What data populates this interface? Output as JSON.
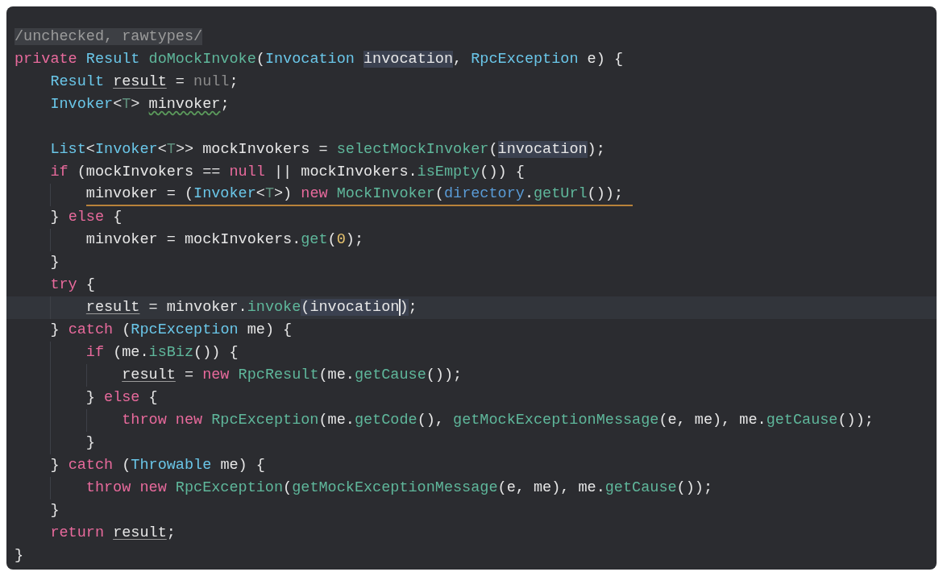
{
  "lines": [
    {
      "kind": "normal",
      "tokens": [
        {
          "text": "/unchecked, rawtypes/",
          "kind": "annotation"
        }
      ]
    },
    {
      "kind": "normal",
      "tokens": [
        {
          "text": "private ",
          "kind": "keyword"
        },
        {
          "text": "Result ",
          "kind": "type"
        },
        {
          "text": "doMockInvoke",
          "kind": "function"
        },
        {
          "text": "(",
          "kind": "plain"
        },
        {
          "text": "Invocation ",
          "kind": "type"
        },
        {
          "text": "invocation",
          "kind": "matched"
        },
        {
          "text": ", ",
          "kind": "plain"
        },
        {
          "text": "RpcException ",
          "kind": "type"
        },
        {
          "text": "e) {",
          "kind": "plain"
        }
      ],
      "children": [
        {
          "kind": "normal",
          "tokens": [
            {
              "text": "Result ",
              "kind": "type"
            },
            {
              "text": "result",
              "kind": "underlined"
            },
            {
              "text": " = ",
              "kind": "plain"
            },
            {
              "text": "null",
              "kind": "muted"
            },
            {
              "text": ";",
              "kind": "plain"
            }
          ]
        },
        {
          "kind": "normal",
          "tokens": [
            {
              "text": "Invoker",
              "kind": "type"
            },
            {
              "text": "<",
              "kind": "plain"
            },
            {
              "text": "T",
              "kind": "typeparam"
            },
            {
              "text": "> ",
              "kind": "plain"
            },
            {
              "text": "minvoker",
              "kind": "wavy"
            },
            {
              "text": ";",
              "kind": "plain"
            }
          ]
        },
        {
          "kind": "blank"
        },
        {
          "kind": "normal",
          "tokens": [
            {
              "text": "List",
              "kind": "type"
            },
            {
              "text": "<",
              "kind": "plain"
            },
            {
              "text": "Invoker",
              "kind": "type"
            },
            {
              "text": "<",
              "kind": "plain"
            },
            {
              "text": "T",
              "kind": "typeparam"
            },
            {
              "text": ">> mockInvokers = ",
              "kind": "plain"
            },
            {
              "text": "selectMockInvoker",
              "kind": "function"
            },
            {
              "text": "(",
              "kind": "plain"
            },
            {
              "text": "invocation",
              "kind": "matched"
            },
            {
              "text": ");",
              "kind": "plain"
            }
          ]
        },
        {
          "kind": "normal",
          "tokens": [
            {
              "text": "if ",
              "kind": "keyword"
            },
            {
              "text": "(mockInvokers == ",
              "kind": "plain"
            },
            {
              "text": "null",
              "kind": "keyword"
            },
            {
              "text": " || mockInvokers.",
              "kind": "plain"
            },
            {
              "text": "isEmpty",
              "kind": "function"
            },
            {
              "text": "()) {",
              "kind": "plain"
            }
          ],
          "children": [
            {
              "kind": "flagged",
              "tokens": [
                {
                  "text": "minvoker = (",
                  "kind": "plain"
                },
                {
                  "text": "Invoker",
                  "kind": "type"
                },
                {
                  "text": "<",
                  "kind": "plain"
                },
                {
                  "text": "T",
                  "kind": "typeparam"
                },
                {
                  "text": ">) ",
                  "kind": "plain"
                },
                {
                  "text": "new ",
                  "kind": "keyword"
                },
                {
                  "text": "MockInvoker",
                  "kind": "function"
                },
                {
                  "text": "(",
                  "kind": "plain"
                },
                {
                  "text": "directory",
                  "kind": "field"
                },
                {
                  "text": ".",
                  "kind": "plain"
                },
                {
                  "text": "getUrl",
                  "kind": "function"
                },
                {
                  "text": "());",
                  "kind": "plain"
                }
              ]
            }
          ]
        },
        {
          "kind": "normal",
          "tokens": [
            {
              "text": "} ",
              "kind": "plain"
            },
            {
              "text": "else ",
              "kind": "keyword"
            },
            {
              "text": "{",
              "kind": "plain"
            }
          ],
          "children": [
            {
              "kind": "normal",
              "tokens": [
                {
                  "text": "minvoker = mockInvokers.",
                  "kind": "plain"
                },
                {
                  "text": "get",
                  "kind": "function"
                },
                {
                  "text": "(",
                  "kind": "plain"
                },
                {
                  "text": "0",
                  "kind": "number"
                },
                {
                  "text": ");",
                  "kind": "plain"
                }
              ]
            }
          ]
        },
        {
          "kind": "normal",
          "tokens": [
            {
              "text": "}",
              "kind": "plain"
            }
          ]
        },
        {
          "kind": "normal",
          "tokens": [
            {
              "text": "try ",
              "kind": "keyword"
            },
            {
              "text": "{",
              "kind": "plain"
            }
          ],
          "children": [
            {
              "kind": "current",
              "tokens": [
                {
                  "text": "result",
                  "kind": "underlined"
                },
                {
                  "text": " = minvoker.",
                  "kind": "plain"
                },
                {
                  "text": "invoke",
                  "kind": "function"
                },
                {
                  "text": "(invocation",
                  "kind": "matched"
                },
                {
                  "text": ")",
                  "kind": "caret"
                },
                {
                  "text": ";",
                  "kind": "plain"
                }
              ]
            }
          ]
        },
        {
          "kind": "normal",
          "tokens": [
            {
              "text": "} ",
              "kind": "plain"
            },
            {
              "text": "catch ",
              "kind": "keyword"
            },
            {
              "text": "(",
              "kind": "plain"
            },
            {
              "text": "RpcException ",
              "kind": "type"
            },
            {
              "text": "me) {",
              "kind": "plain"
            }
          ],
          "children": [
            {
              "kind": "normal",
              "tokens": [
                {
                  "text": "if ",
                  "kind": "keyword"
                },
                {
                  "text": "(me.",
                  "kind": "plain"
                },
                {
                  "text": "isBiz",
                  "kind": "function"
                },
                {
                  "text": "()) {",
                  "kind": "plain"
                }
              ],
              "children": [
                {
                  "kind": "normal",
                  "tokens": [
                    {
                      "text": "result",
                      "kind": "underlined"
                    },
                    {
                      "text": " = ",
                      "kind": "plain"
                    },
                    {
                      "text": "new ",
                      "kind": "keyword"
                    },
                    {
                      "text": "RpcResult",
                      "kind": "function"
                    },
                    {
                      "text": "(me.",
                      "kind": "plain"
                    },
                    {
                      "text": "getCause",
                      "kind": "function"
                    },
                    {
                      "text": "());",
                      "kind": "plain"
                    }
                  ]
                }
              ]
            },
            {
              "kind": "normal",
              "tokens": [
                {
                  "text": "} ",
                  "kind": "plain"
                },
                {
                  "text": "else ",
                  "kind": "keyword"
                },
                {
                  "text": "{",
                  "kind": "plain"
                }
              ],
              "children": [
                {
                  "kind": "normal",
                  "tokens": [
                    {
                      "text": "throw new ",
                      "kind": "keyword"
                    },
                    {
                      "text": "RpcException",
                      "kind": "function"
                    },
                    {
                      "text": "(me.",
                      "kind": "plain"
                    },
                    {
                      "text": "getCode",
                      "kind": "function"
                    },
                    {
                      "text": "(), ",
                      "kind": "plain"
                    },
                    {
                      "text": "getMockExceptionMessage",
                      "kind": "function"
                    },
                    {
                      "text": "(e, me), me.",
                      "kind": "plain"
                    },
                    {
                      "text": "getCause",
                      "kind": "function"
                    },
                    {
                      "text": "());",
                      "kind": "plain"
                    }
                  ]
                }
              ]
            },
            {
              "kind": "normal",
              "tokens": [
                {
                  "text": "}",
                  "kind": "plain"
                }
              ]
            }
          ]
        },
        {
          "kind": "normal",
          "tokens": [
            {
              "text": "} ",
              "kind": "plain"
            },
            {
              "text": "catch ",
              "kind": "keyword"
            },
            {
              "text": "(",
              "kind": "plain"
            },
            {
              "text": "Throwable ",
              "kind": "type"
            },
            {
              "text": "me) {",
              "kind": "plain"
            }
          ],
          "children": [
            {
              "kind": "normal",
              "tokens": [
                {
                  "text": "throw new ",
                  "kind": "keyword"
                },
                {
                  "text": "RpcException",
                  "kind": "function"
                },
                {
                  "text": "(",
                  "kind": "plain"
                },
                {
                  "text": "getMockExceptionMessage",
                  "kind": "function"
                },
                {
                  "text": "(e, me), me.",
                  "kind": "plain"
                },
                {
                  "text": "getCause",
                  "kind": "function"
                },
                {
                  "text": "());",
                  "kind": "plain"
                }
              ]
            }
          ]
        },
        {
          "kind": "normal",
          "tokens": [
            {
              "text": "}",
              "kind": "plain"
            }
          ]
        },
        {
          "kind": "normal",
          "tokens": [
            {
              "text": "return ",
              "kind": "keyword"
            },
            {
              "text": "result",
              "kind": "underlined"
            },
            {
              "text": ";",
              "kind": "plain"
            }
          ]
        }
      ]
    },
    {
      "kind": "normal",
      "tokens": [
        {
          "text": "}",
          "kind": "plain"
        }
      ]
    }
  ]
}
